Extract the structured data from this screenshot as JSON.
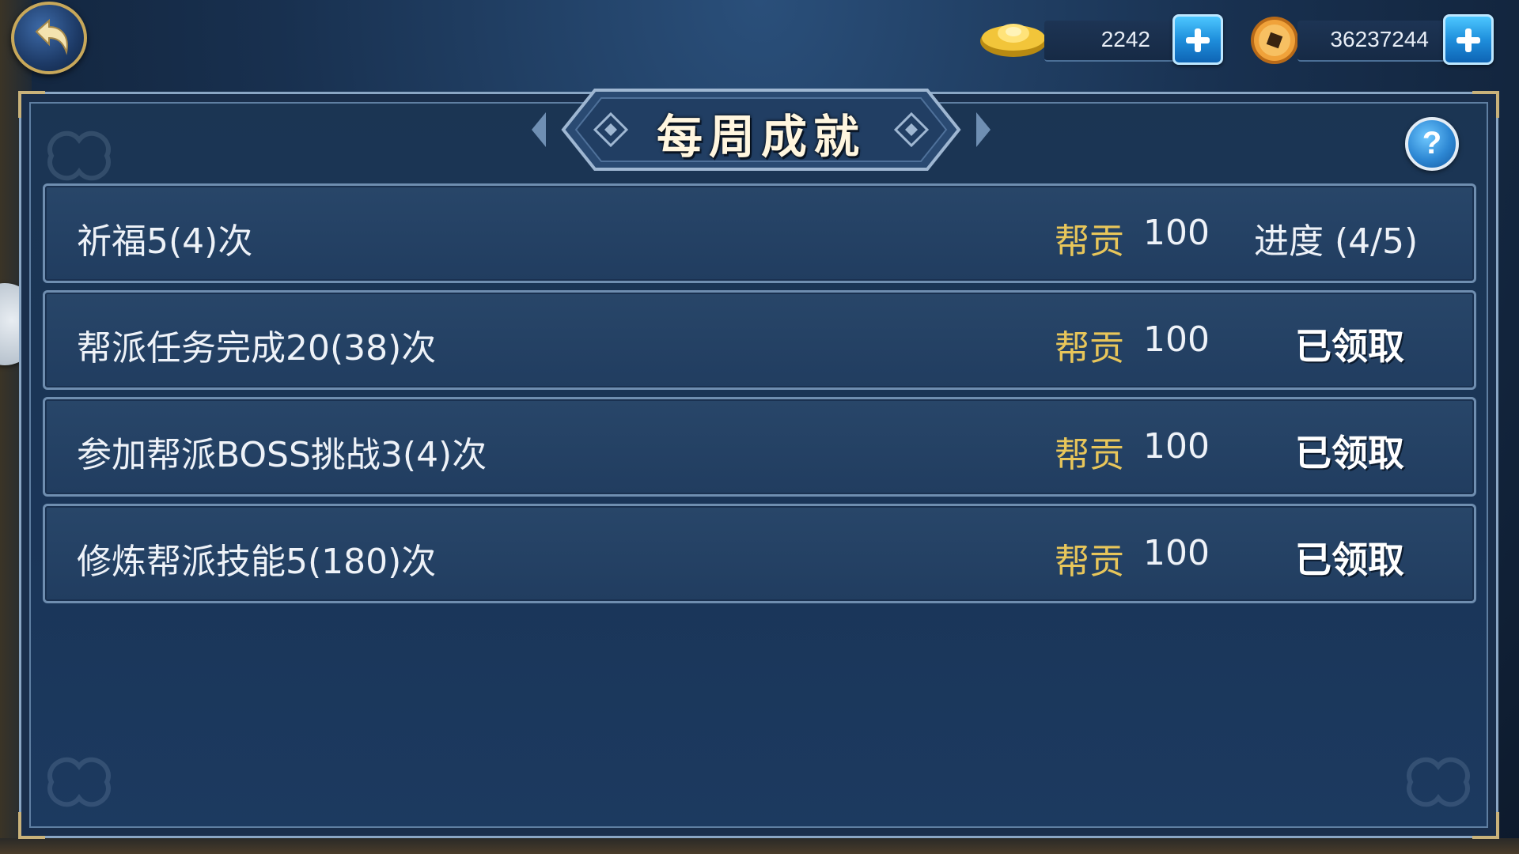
{
  "header": {
    "back_icon": "back-arrow-icon",
    "currencies": [
      {
        "icon": "gold-ingot-icon",
        "value": "2242",
        "add_icon": "plus-icon"
      },
      {
        "icon": "copper-coin-icon",
        "value": "36237244",
        "add_icon": "plus-icon"
      }
    ]
  },
  "panel": {
    "title": "每周成就",
    "help_label": "?"
  },
  "achievements": [
    {
      "task": "祈福5(4)次",
      "reward_label": "帮贡",
      "reward_value": "100",
      "status": "进度 (4/5)"
    },
    {
      "task": "帮派任务完成20(38)次",
      "reward_label": "帮贡",
      "reward_value": "100",
      "status": "已领取"
    },
    {
      "task": "参加帮派BOSS挑战3(4)次",
      "reward_label": "帮贡",
      "reward_value": "100",
      "status": "已领取"
    },
    {
      "task": "修炼帮派技能5(180)次",
      "reward_label": "帮贡",
      "reward_value": "100",
      "status": "已领取"
    }
  ],
  "colors": {
    "reward_label": "#e8c65a",
    "panel_bg": "#1b3553",
    "row_border": "#6f8eb0",
    "plus_button": "#1f8fdc"
  }
}
